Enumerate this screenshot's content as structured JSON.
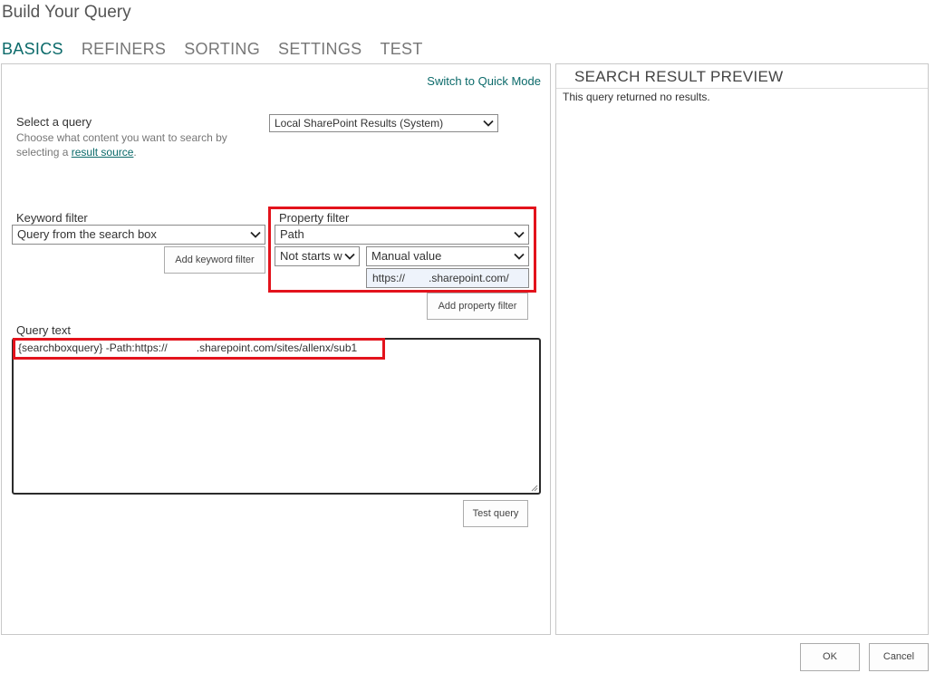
{
  "dialog": {
    "title": "Build Your Query"
  },
  "tabs": [
    {
      "label": "BASICS"
    },
    {
      "label": "REFINERS"
    },
    {
      "label": "SORTING"
    },
    {
      "label": "SETTINGS"
    },
    {
      "label": "TEST"
    }
  ],
  "basics": {
    "switch_mode_link": "Switch to Quick Mode",
    "select_query": {
      "label": "Select a query",
      "help_line1": "Choose what content you want to search by",
      "help_prefix": "selecting a",
      "help_link": "result source",
      "help_suffix": ".",
      "value": "Local SharePoint Results (System)"
    },
    "keyword_filter": {
      "label": "Keyword filter",
      "value": "Query from the search box",
      "add_button": "Add keyword filter"
    },
    "property_filter": {
      "label": "Property filter",
      "property_value": "Path",
      "operator_value": "Not starts w",
      "value_type": "Manual value",
      "value_prefix": "https://",
      "value_suffix": ".sharepoint.com/",
      "add_button": "Add property filter"
    },
    "query_text": {
      "label": "Query text",
      "value_prefix": "{searchboxquery} -Path:https://",
      "value_suffix": ".sharepoint.com/sites/allenx/sub1"
    },
    "test_button": "Test query"
  },
  "preview": {
    "title": "SEARCH RESULT PREVIEW",
    "message": "This query returned no results."
  },
  "footer": {
    "ok_label": "OK",
    "cancel_label": "Cancel"
  },
  "colors": {
    "accent": "#0b6a6a",
    "highlight": "#e3131c"
  },
  "icons": {
    "dropdown": "chevron-down-icon",
    "resize": "resize-grip-icon"
  }
}
